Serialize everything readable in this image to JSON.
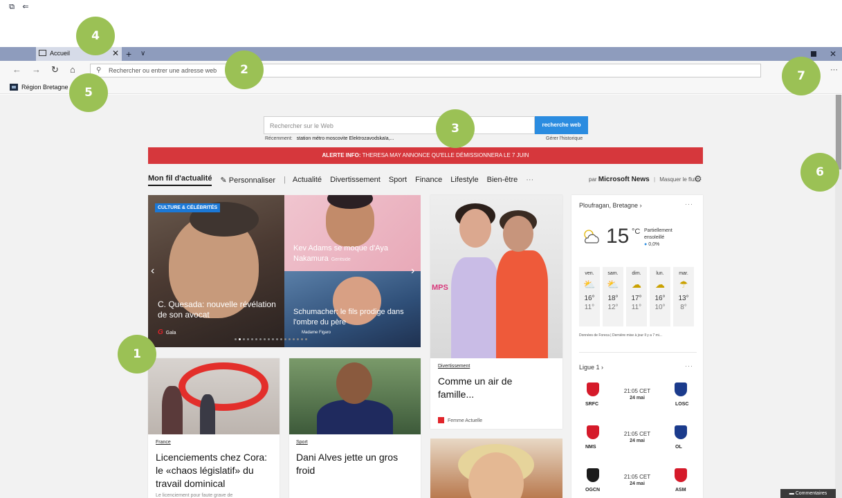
{
  "browser": {
    "tab": {
      "title": "Accueil"
    },
    "address_placeholder": "Rechercher ou entrer une adresse web",
    "favorites": [
      {
        "label": "Région Bretagne"
      }
    ]
  },
  "search": {
    "placeholder": "Rechercher sur le Web",
    "button": "recherche web",
    "recent_label": "Récemment:",
    "recent_query": "station métro moscovite Elektrozavodskaïa,...",
    "history_link": "Gérer l'historique"
  },
  "alert": {
    "prefix": "ALERTE INFO:",
    "text": "THERESA MAY ANNONCE QU'ELLE DÉMISSIONNERA LE 7 JUIN"
  },
  "feed_nav": {
    "active": "Mon fil d'actualité",
    "personalize": "Personnaliser",
    "items": [
      "Actualité",
      "Divertissement",
      "Sport",
      "Finance",
      "Lifestyle",
      "Bien-être"
    ],
    "more": "···",
    "by": "par",
    "brand": "Microsoft News",
    "hide": "Masquer le flux"
  },
  "carousel": {
    "badge": "CULTURE & CÉLÉBRITÉS",
    "main_title": "C. Quesada: nouvelle révélation de son avocat",
    "main_source": "Gala",
    "top_right_title": "Kev Adams se moque d'Aya Nakamura",
    "top_right_source": "Gentside",
    "bottom_right_title": "Schumacher: le fils prodige dans l'ombre du père",
    "bottom_right_source": "Madame Figaro",
    "slide_count": 18,
    "active_slide": 2
  },
  "cards": [
    {
      "category": "France",
      "title": "Licenciements chez Cora: le «chaos législatif» du travail dominical",
      "excerpt": "Le licenciement pour faute grave de"
    },
    {
      "category": "Sport",
      "title": "Dani Alves jette un gros froid"
    },
    {
      "category": "Divertissement",
      "title": "Comme un air de famille...",
      "source": "Femme Actuelle",
      "image_text": "MPS"
    }
  ],
  "weather": {
    "location": "Ploufragan, Bretagne",
    "temp": "15",
    "unit": "°C",
    "condition": "Partiellement ensoleillé",
    "precip": "0,0%",
    "forecast": [
      {
        "day": "ven.",
        "hi": "16°",
        "lo": "11°",
        "icon": "sun-cloud-icon"
      },
      {
        "day": "sam.",
        "hi": "18°",
        "lo": "12°",
        "icon": "sun-cloud-icon"
      },
      {
        "day": "dim.",
        "hi": "17°",
        "lo": "11°",
        "icon": "cloud-icon"
      },
      {
        "day": "lun.",
        "hi": "16°",
        "lo": "10°",
        "icon": "cloud-icon"
      },
      {
        "day": "mar.",
        "hi": "13°",
        "lo": "8°",
        "icon": "sun-rain-icon"
      }
    ],
    "credit": "Données de Foreca | Dernière mise à jour Il y a 7 mi..."
  },
  "league": {
    "title": "Ligue 1",
    "matches": [
      {
        "home": "SRFC",
        "away": "LOSC",
        "time": "21:05 CET",
        "date": "24 mai",
        "home_color": "#d51a2a",
        "away_color": "#1b3b8c"
      },
      {
        "home": "NMS",
        "away": "OL",
        "time": "21:05 CET",
        "date": "24 mai",
        "home_color": "#d51a2a",
        "away_color": "#1b3b8c"
      },
      {
        "home": "OGCN",
        "away": "ASM",
        "time": "21:05 CET",
        "date": "24 mai",
        "home_color": "#1b1b1b",
        "away_color": "#d51a2a"
      }
    ]
  },
  "markers": [
    "1",
    "2",
    "3",
    "4",
    "5",
    "6",
    "7"
  ],
  "feedback": "Commentaires",
  "colors": {
    "alert": "#d6373c",
    "search_button": "#2b8ce0",
    "marker": "#9bc155",
    "tabbar": "#8e9cbd"
  }
}
